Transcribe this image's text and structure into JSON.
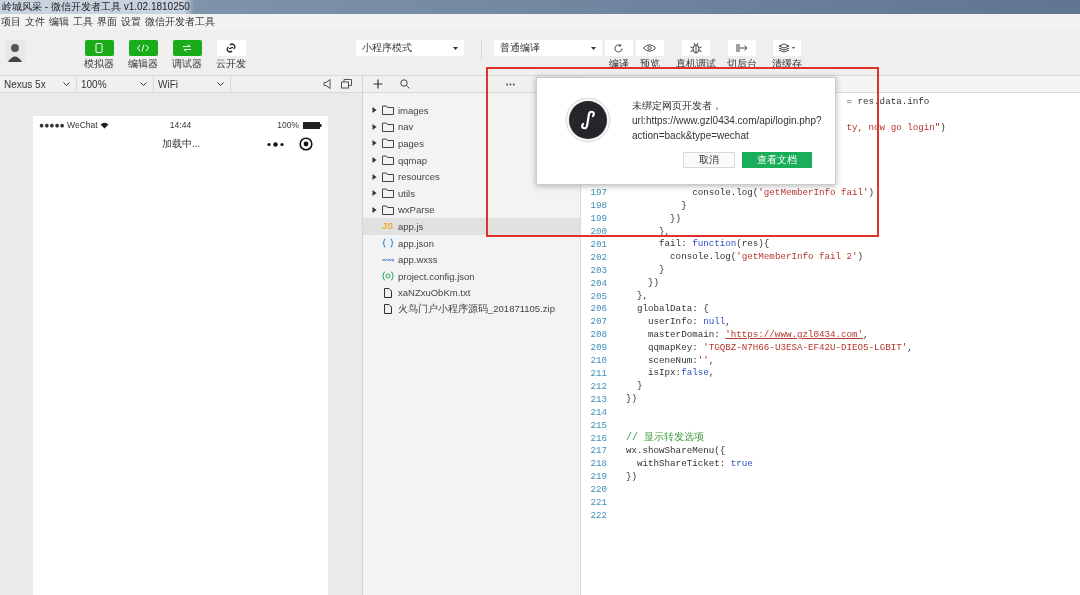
{
  "window": {
    "title": "岭城风采 - 微信开发者工具 v1.02.1810250"
  },
  "menu": [
    "项目",
    "文件",
    "编辑",
    "工具",
    "界面",
    "设置",
    "微信开发者工具"
  ],
  "toolbar": {
    "mode_buttons": [
      {
        "label": "模拟器",
        "kind": "phone",
        "on": true
      },
      {
        "label": "编辑器",
        "kind": "code",
        "on": true
      },
      {
        "label": "调试器",
        "kind": "debug",
        "on": true
      },
      {
        "label": "云开发",
        "kind": "cloud",
        "on": false
      }
    ],
    "mode_select": "小程序模式",
    "compile_select": "普通编译",
    "actions": [
      {
        "label": "编译",
        "kind": "refresh"
      },
      {
        "label": "预览",
        "kind": "eye"
      },
      {
        "label": "真机调试",
        "kind": "bug"
      },
      {
        "label": "切后台",
        "kind": "switch"
      },
      {
        "label": "清缓存",
        "kind": "layers"
      }
    ]
  },
  "simulator": {
    "device": "Nexus 5x",
    "zoom": "100%",
    "network": "WiFi",
    "status": {
      "carrier": "●●●●● WeChat",
      "time": "14:44",
      "battery": "100%"
    },
    "nav_title": "加载中..."
  },
  "files": [
    {
      "name": "images",
      "kind": "folder",
      "expanded": false,
      "selected": false
    },
    {
      "name": "nav",
      "kind": "folder",
      "expanded": false,
      "selected": false
    },
    {
      "name": "pages",
      "kind": "folder",
      "expanded": false,
      "selected": false
    },
    {
      "name": "qqmap",
      "kind": "folder",
      "expanded": false,
      "selected": false
    },
    {
      "name": "resources",
      "kind": "folder",
      "expanded": false,
      "selected": false
    },
    {
      "name": "utils",
      "kind": "folder",
      "expanded": false,
      "selected": false
    },
    {
      "name": "wxParse",
      "kind": "folder",
      "expanded": false,
      "selected": false
    },
    {
      "name": "app.js",
      "kind": "js",
      "badge": "JS",
      "selected": true
    },
    {
      "name": "app.json",
      "kind": "json",
      "selected": false
    },
    {
      "name": "app.wxss",
      "kind": "wxss",
      "selected": false
    },
    {
      "name": "project.config.json",
      "kind": "config",
      "selected": false
    },
    {
      "name": "xaNZxuObKm.txt",
      "kind": "file",
      "selected": false
    },
    {
      "name": "火鸟门户小程序源码_201871105.zip",
      "kind": "file",
      "selected": false
    }
  ],
  "editor": {
    "tails": [
      {
        "segments": [
          {
            "t": "= res.data.info",
            "kind": "plain"
          }
        ]
      },
      {
        "segments": [
          {
            "t": "ty, now go login\"",
            "kind": "string"
          },
          {
            "t": ")",
            "kind": "plain"
          }
        ]
      }
    ],
    "lines": [
      {
        "number": "197",
        "segments": [
          {
            "t": "            console.log(",
            "kind": "plain"
          },
          {
            "t": "'getMemberInfo fail'",
            "kind": "string"
          },
          {
            "t": ")",
            "kind": "plain"
          }
        ]
      },
      {
        "number": "198",
        "segments": [
          {
            "t": "          }",
            "kind": "plain"
          }
        ]
      },
      {
        "number": "199",
        "segments": [
          {
            "t": "        })",
            "kind": "plain"
          }
        ]
      },
      {
        "number": "200",
        "segments": [
          {
            "t": "      },",
            "kind": "plain"
          }
        ]
      },
      {
        "number": "201",
        "segments": [
          {
            "t": "      fail: ",
            "kind": "plain"
          },
          {
            "t": "function",
            "kind": "keyword"
          },
          {
            "t": "(res){",
            "kind": "plain"
          }
        ]
      },
      {
        "number": "202",
        "segments": [
          {
            "t": "        console.log(",
            "kind": "plain"
          },
          {
            "t": "'getMemberInfo fail 2'",
            "kind": "string"
          },
          {
            "t": ")",
            "kind": "plain"
          }
        ]
      },
      {
        "number": "203",
        "segments": [
          {
            "t": "      }",
            "kind": "plain"
          }
        ]
      },
      {
        "number": "204",
        "segments": [
          {
            "t": "    })",
            "kind": "plain"
          }
        ]
      },
      {
        "number": "205",
        "segments": [
          {
            "t": "  },",
            "kind": "plain"
          }
        ]
      },
      {
        "number": "206",
        "segments": [
          {
            "t": "  globalData: {",
            "kind": "plain"
          }
        ]
      },
      {
        "number": "207",
        "segments": [
          {
            "t": "    userInfo: ",
            "kind": "plain"
          },
          {
            "t": "null",
            "kind": "keyword"
          },
          {
            "t": ",",
            "kind": "plain"
          }
        ]
      },
      {
        "number": "208",
        "segments": [
          {
            "t": "    masterDomain: ",
            "kind": "plain"
          },
          {
            "t": "'https://www.gzl0434.com'",
            "kind": "url"
          },
          {
            "t": ",",
            "kind": "plain"
          }
        ]
      },
      {
        "number": "209",
        "segments": [
          {
            "t": "    qqmapKey: ",
            "kind": "plain"
          },
          {
            "t": "'TGQBZ-N7H66-U3ESA-EF42U-DIEO5-LGBIT'",
            "kind": "string"
          },
          {
            "t": ",",
            "kind": "plain"
          }
        ]
      },
      {
        "number": "210",
        "segments": [
          {
            "t": "    sceneNum:",
            "kind": "plain"
          },
          {
            "t": "''",
            "kind": "string"
          },
          {
            "t": ",",
            "kind": "plain"
          }
        ]
      },
      {
        "number": "211",
        "segments": [
          {
            "t": "    isIpx:",
            "kind": "plain"
          },
          {
            "t": "false",
            "kind": "keyword"
          },
          {
            "t": ",",
            "kind": "plain"
          }
        ]
      },
      {
        "number": "212",
        "segments": [
          {
            "t": "  }",
            "kind": "plain"
          }
        ]
      },
      {
        "number": "213",
        "segments": [
          {
            "t": "})",
            "kind": "plain"
          }
        ]
      },
      {
        "number": "214"
      },
      {
        "number": "215"
      },
      {
        "number": "216",
        "segments": [
          {
            "t": "// 显示转发选项",
            "kind": "comment"
          }
        ]
      },
      {
        "number": "217",
        "segments": [
          {
            "t": "wx.showShareMenu({",
            "kind": "plain"
          }
        ]
      },
      {
        "number": "218",
        "segments": [
          {
            "t": "  withShareTicket: ",
            "kind": "plain"
          },
          {
            "t": "true",
            "kind": "keyword"
          }
        ]
      },
      {
        "number": "219",
        "segments": [
          {
            "t": "})",
            "kind": "plain"
          }
        ]
      },
      {
        "number": "220"
      },
      {
        "number": "221"
      },
      {
        "number": "222"
      }
    ]
  },
  "dialog": {
    "lines": [
      "未绑定网页开发者，",
      "url:https://www.gzl0434.com/api/login.php?",
      "action=back&type=wechat"
    ],
    "buttons": [
      {
        "label": "取消",
        "kind": "secondary"
      },
      {
        "label": "查看文档",
        "kind": "primary"
      }
    ]
  }
}
